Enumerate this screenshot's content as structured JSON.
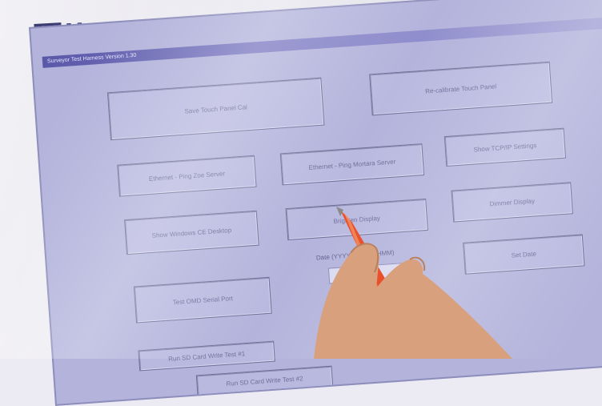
{
  "brand": {
    "name": "Mortara"
  },
  "window": {
    "title": "Surveyor Test Harness Version 1.30"
  },
  "buttons": {
    "save_touch_panel_cal": "Save Touch Panel Cal",
    "recalibrate_touch_panel": "Re-calibrate Touch Panel",
    "ethernet_ping_zoe": "Ethernet - Ping Zoe Server",
    "ethernet_ping_mortara": "Ethernet - Ping Mortara Server",
    "show_tcpip": "Show TCP/IP Settings",
    "show_windows_ce_desktop": "Show Windows CE Desktop",
    "brighten_display": "Brighten Display",
    "dimmer_display": "Dimmer Display",
    "set_date": "Set Date",
    "test_omd_serial": "Test OMD Serial Port",
    "run_sd_test_1": "Run SD Card Write Test #1",
    "run_sd_test_2": "Run SD Card Write Test #2"
  },
  "date_field": {
    "label": "Date (YYYYMMDD HHMM)",
    "value": ""
  },
  "icons": {
    "logo": "heart-logo-icon",
    "pen": "stylus-pen-icon"
  },
  "colors": {
    "screen_bg": "#b3b3dc",
    "titlebar": "#5a58a8",
    "brand": "#3c3c72",
    "pen": "#e8512c"
  }
}
